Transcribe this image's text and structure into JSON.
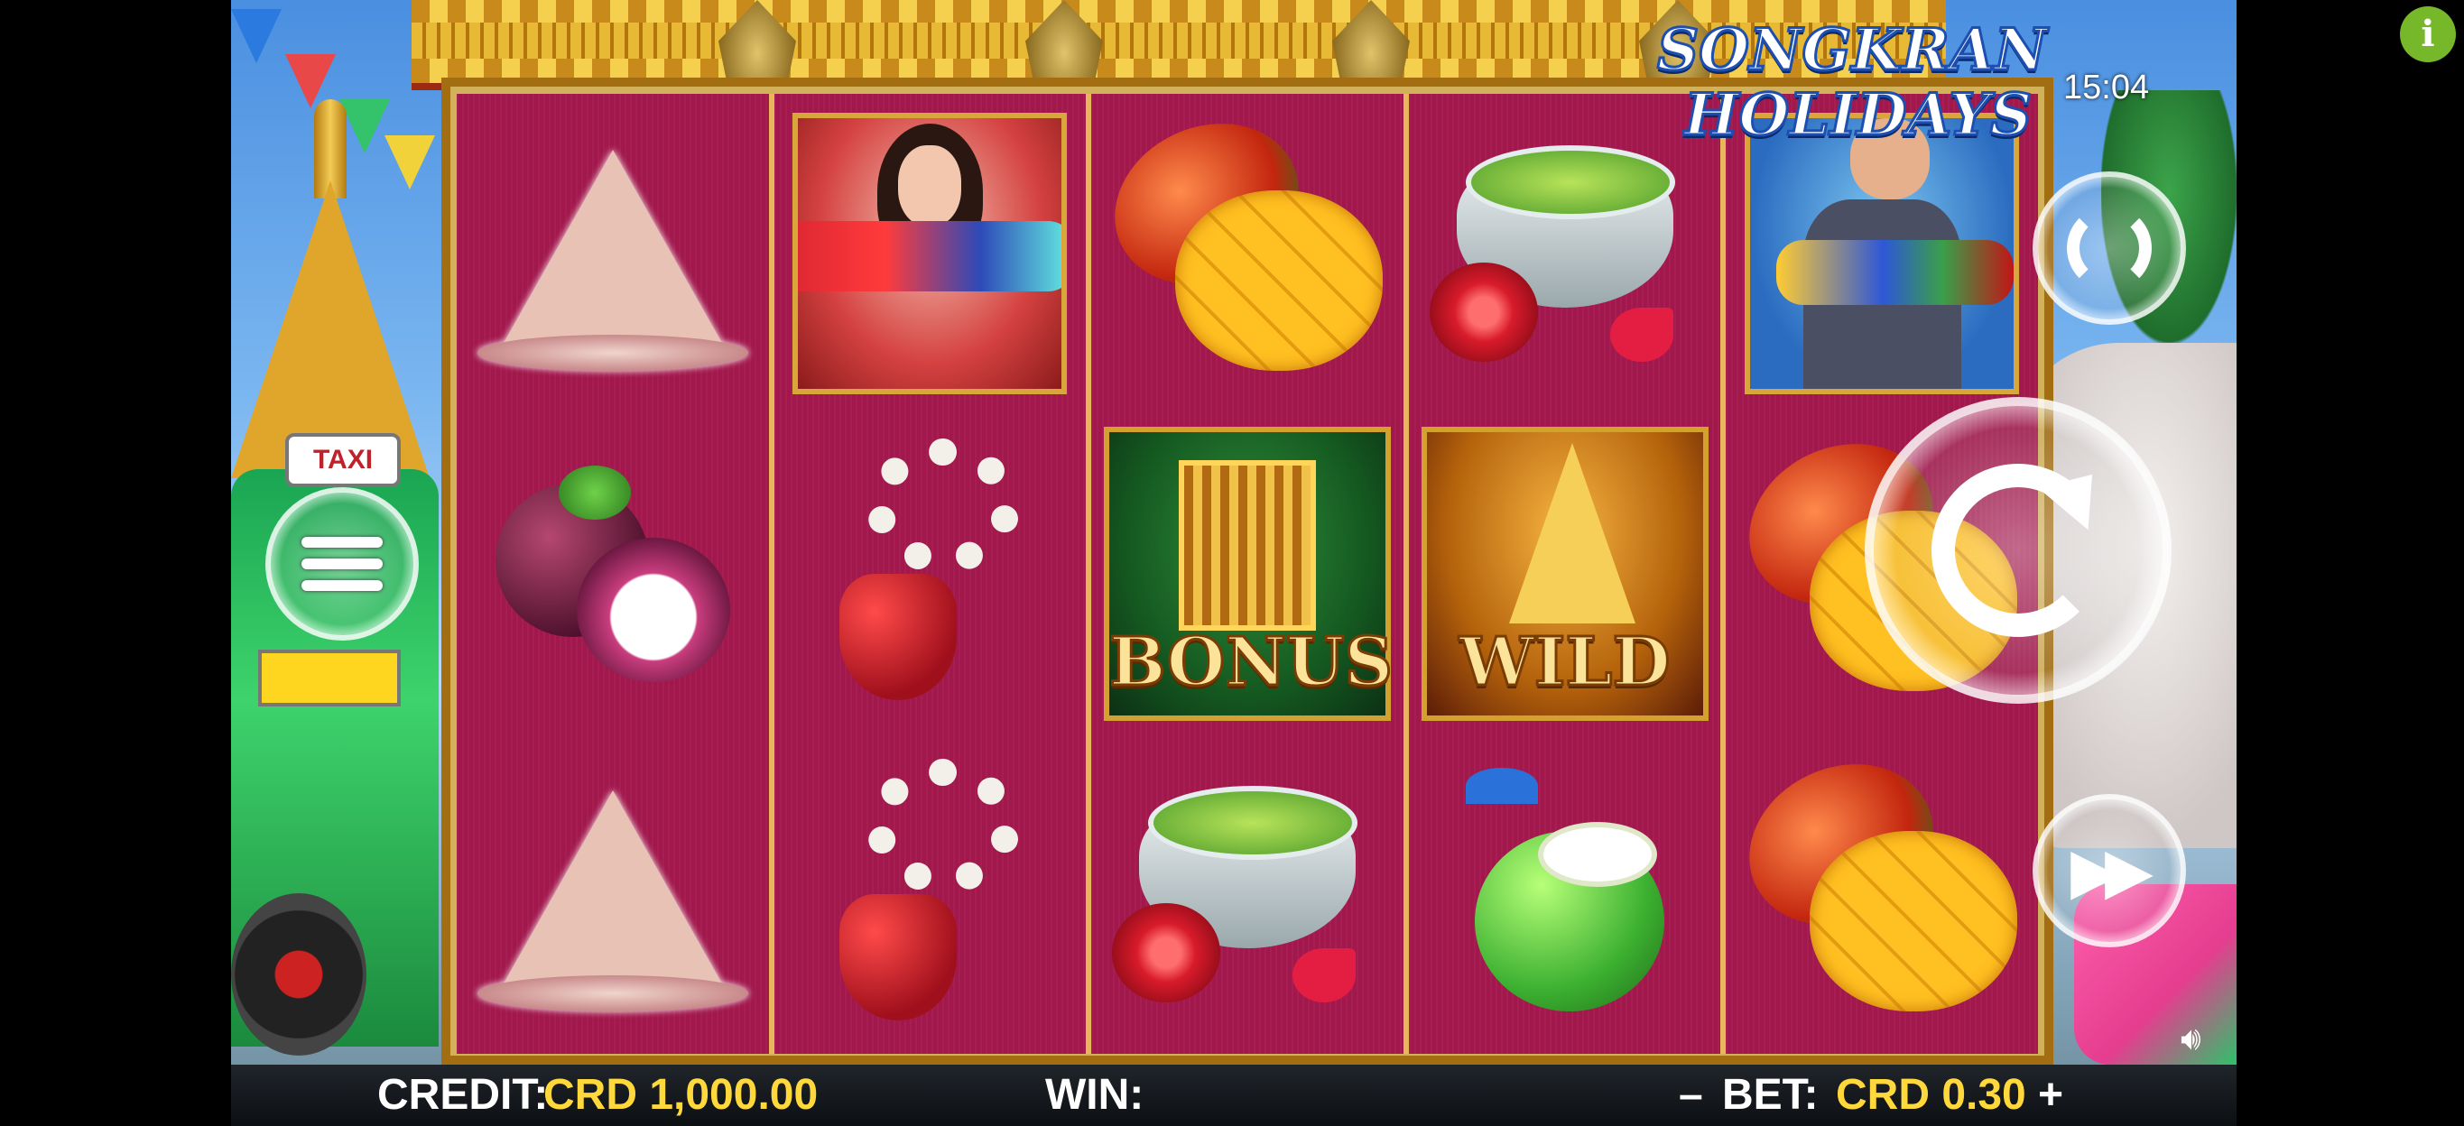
{
  "game": {
    "logo_line1": "SONGKRAN",
    "logo_line2": "HOLIDAYS",
    "clock": "15:04",
    "taxi_sign": "TAXI"
  },
  "reels": [
    [
      "pagoda-hat",
      "mangosteen",
      "pagoda-hat"
    ],
    [
      "woman-water-gun",
      "flower-garland",
      "flower-garland"
    ],
    [
      "mango",
      "bonus",
      "flower-bowl"
    ],
    [
      "flower-bowl",
      "wild",
      "coconut"
    ],
    [
      "man-water-gun",
      "mango",
      "mango"
    ]
  ],
  "symbols": {
    "bonus_label": "BONUS",
    "wild_label": "WILD"
  },
  "controls": {
    "menu_icon": "hamburger-icon",
    "autoplay_icon": "autoplay-icon",
    "spin_icon": "spin-icon",
    "turbo_icon": "fast-forward-icon",
    "sound_icon": "speaker-icon",
    "info_label": "i"
  },
  "status": {
    "credit_label": "CREDIT:",
    "credit_value": "CRD 1,000.00",
    "win_label": "WIN:",
    "win_value": "",
    "bet_minus": "–",
    "bet_label": "BET:",
    "bet_value": "CRD 0.30",
    "bet_plus": "+"
  },
  "colors": {
    "reel_bg": "#a2184c",
    "value_yellow": "#ffd83b",
    "info_green": "#76b82a"
  }
}
